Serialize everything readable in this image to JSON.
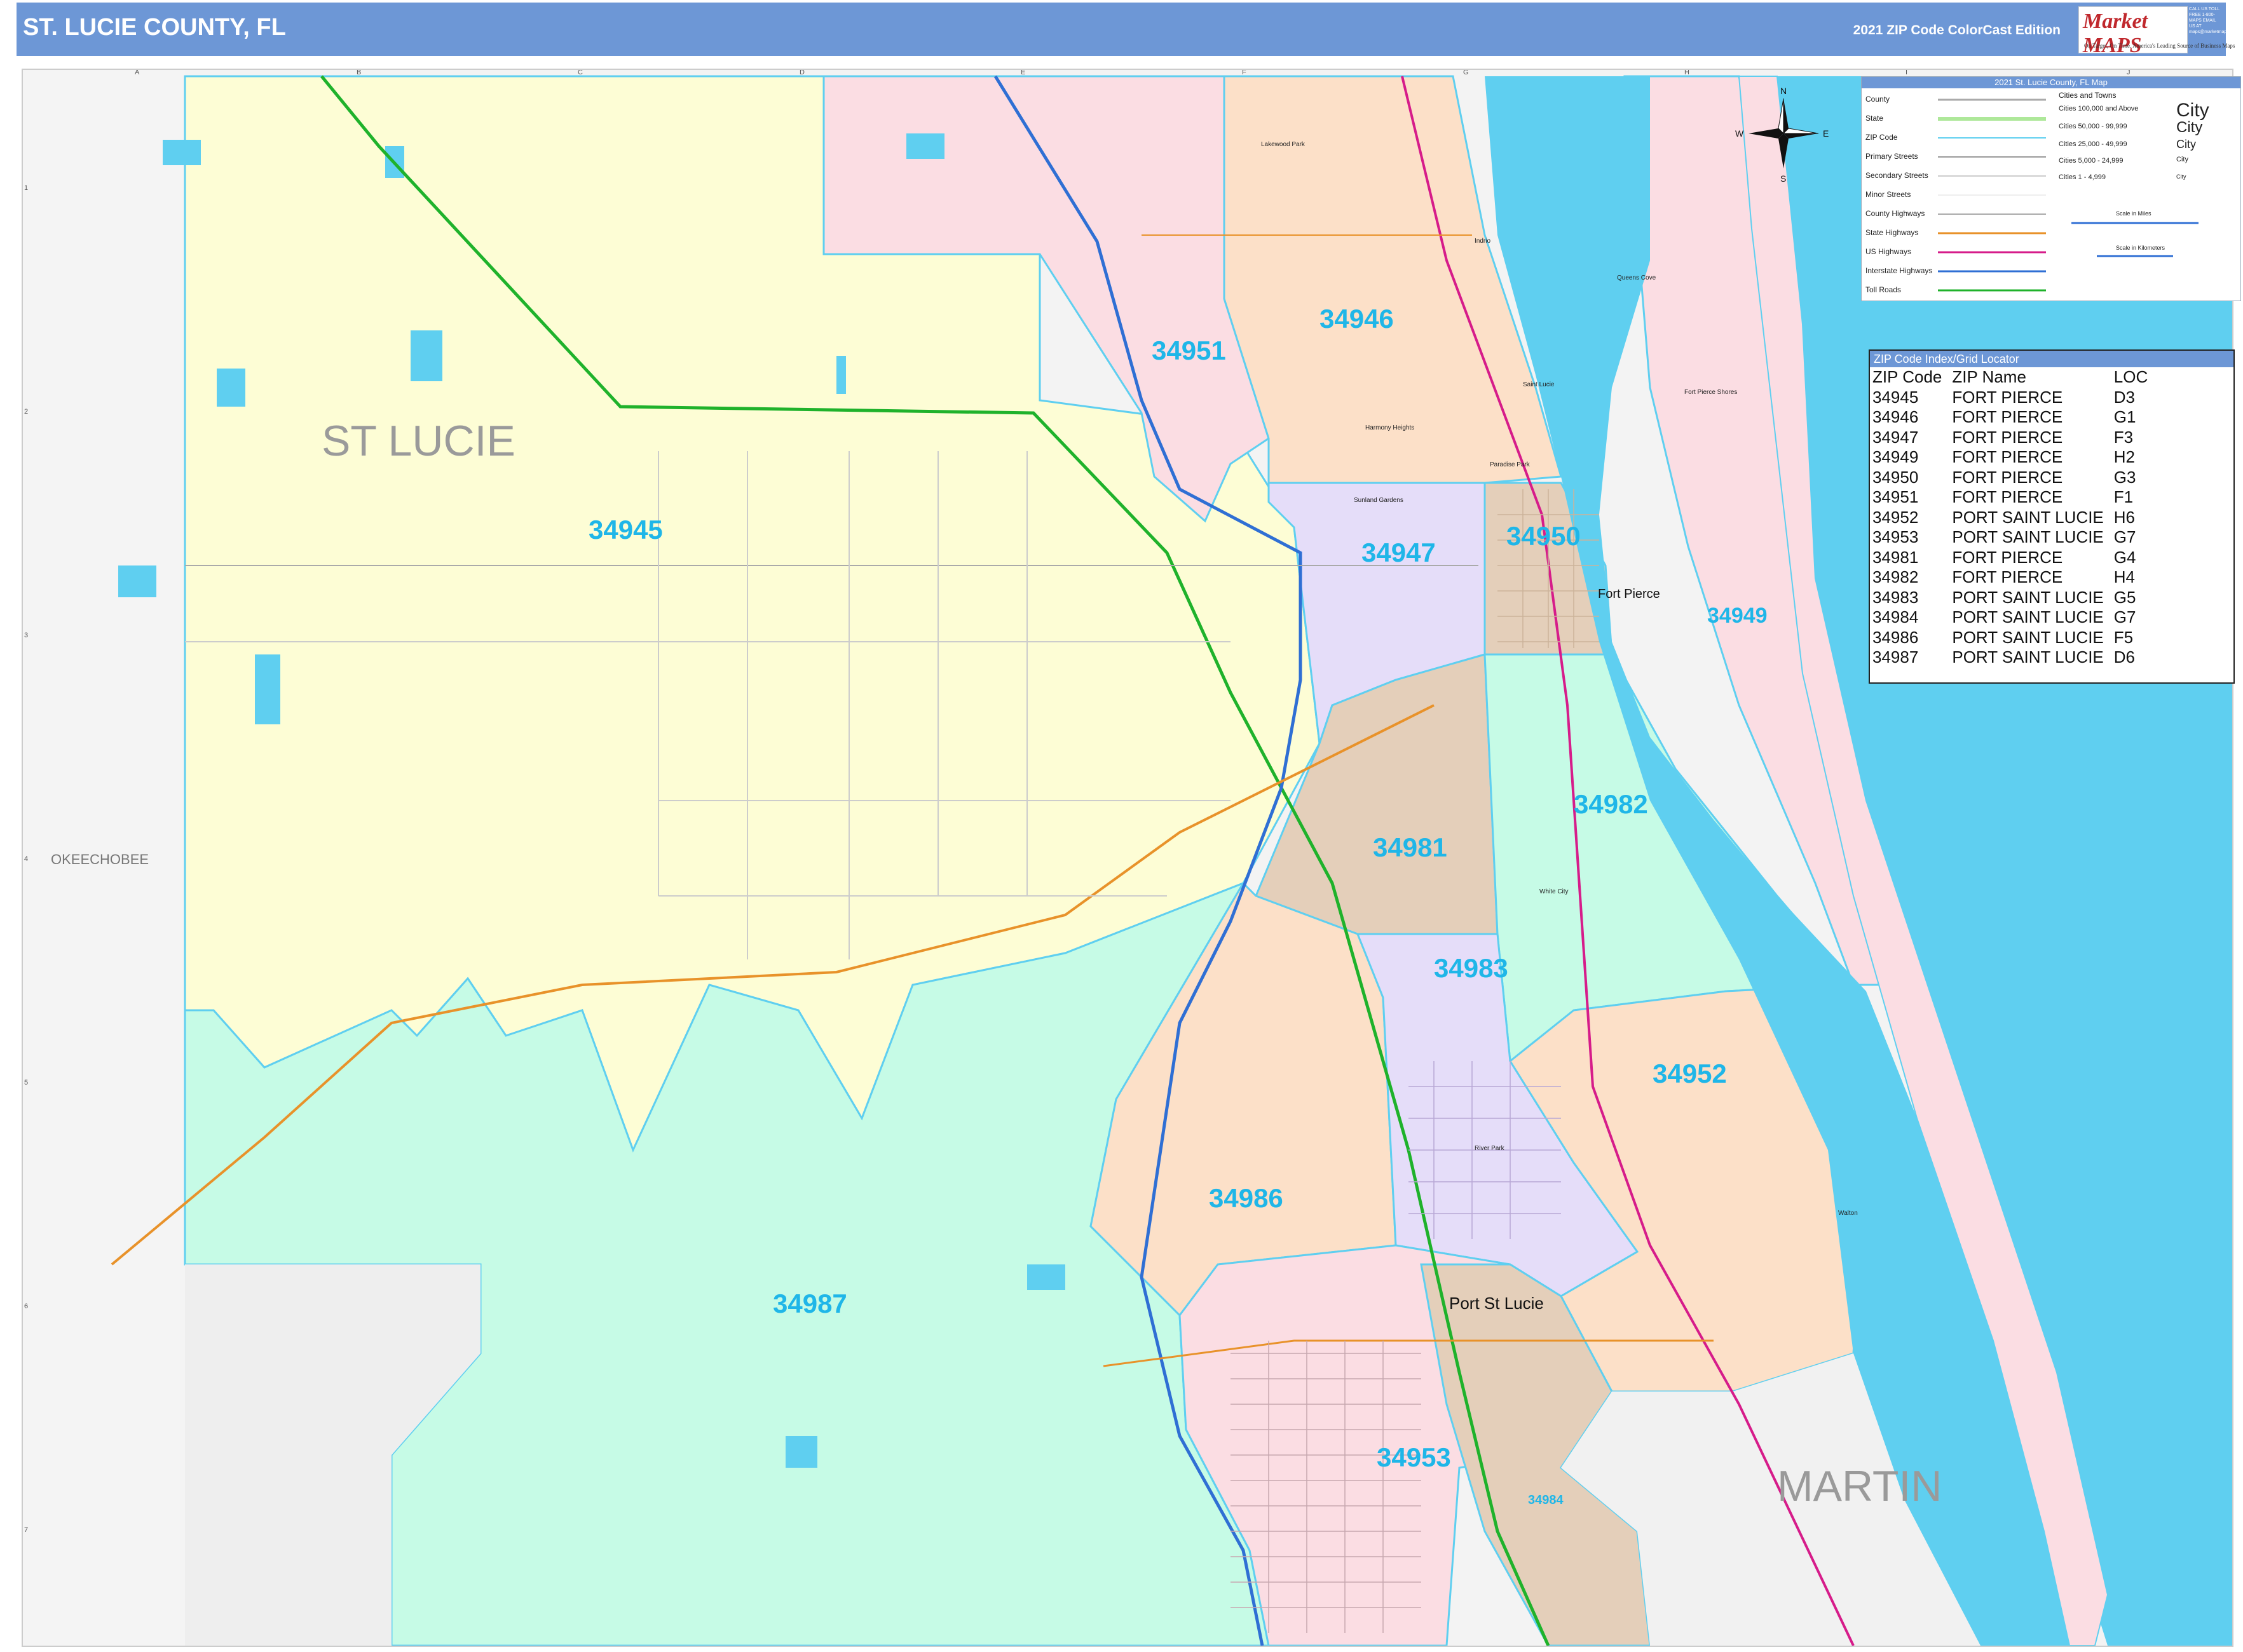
{
  "header": {
    "title": "ST. LUCIE COUNTY, FL",
    "edition": "2021 ZIP Code ColorCast Edition",
    "brand_name": "Market MAPS",
    "brand_tagline_1": "On Target, On Time.",
    "brand_tagline_2": "America's Leading Source of Business Maps",
    "contact": "CALL US TOLL FREE 1-800-MAPS EMAIL US AT maps@marketmaps.com"
  },
  "colors": {
    "header_blue": "#6d97d6",
    "water": "#5fcff0",
    "zip_label": "#1fb6e8",
    "zone_yellow": "#fdfdd5",
    "zone_green": "#c6fbe6",
    "zone_pink": "#fbdde3",
    "zone_peach": "#fce0c8",
    "zone_lavender": "#e5ddf9",
    "zone_tan": "#e4cfba",
    "interstate": "#2f6fd4",
    "turnpike": "#1fb22b",
    "us_highway": "#d61c8a",
    "state_highway": "#e8922a"
  },
  "grid": {
    "columns": [
      "A",
      "B",
      "C",
      "D",
      "E",
      "F",
      "G",
      "H",
      "I",
      "J"
    ],
    "rows": [
      "1",
      "2",
      "3",
      "4",
      "5",
      "6",
      "7"
    ]
  },
  "compass": {
    "n": "N",
    "s": "S",
    "e": "E",
    "w": "W"
  },
  "legend": {
    "title": "2021 St. Lucie County, FL Map",
    "left_items": [
      "County",
      "State",
      "ZIP Code",
      "Primary Streets",
      "Secondary Streets",
      "Minor Streets",
      "County Highways",
      "State Highways",
      "US Highways",
      "Interstate Highways",
      "Toll Roads"
    ],
    "right_title": "Cities and Towns",
    "right_items": [
      {
        "label": "Cities 100,000 and Above",
        "sample": "City"
      },
      {
        "label": "Cities 50,000 - 99,999",
        "sample": "City"
      },
      {
        "label": "Cities 25,000 - 49,999",
        "sample": "City"
      },
      {
        "label": "Cities 5,000 - 24,999",
        "sample": "City"
      },
      {
        "label": "Cities 1 - 4,999",
        "sample": "City"
      }
    ],
    "scale_miles": "Scale in Miles",
    "scale_km": "Scale in Kilometers"
  },
  "zip_index": {
    "title": "ZIP Code Index/Grid Locator",
    "headers": [
      "ZIP Code",
      "ZIP Name",
      "LOC"
    ],
    "rows": [
      [
        "34945",
        "FORT PIERCE",
        "D3"
      ],
      [
        "34946",
        "FORT PIERCE",
        "G1"
      ],
      [
        "34947",
        "FORT PIERCE",
        "F3"
      ],
      [
        "34949",
        "FORT PIERCE",
        "H2"
      ],
      [
        "34950",
        "FORT PIERCE",
        "G3"
      ],
      [
        "34951",
        "FORT PIERCE",
        "F1"
      ],
      [
        "34952",
        "PORT SAINT LUCIE",
        "H6"
      ],
      [
        "34953",
        "PORT SAINT LUCIE",
        "G7"
      ],
      [
        "34981",
        "FORT PIERCE",
        "G4"
      ],
      [
        "34982",
        "FORT PIERCE",
        "H4"
      ],
      [
        "34983",
        "PORT SAINT LUCIE",
        "G5"
      ],
      [
        "34984",
        "PORT SAINT LUCIE",
        "G7"
      ],
      [
        "34986",
        "PORT SAINT LUCIE",
        "F5"
      ],
      [
        "34987",
        "PORT SAINT LUCIE",
        "D6"
      ]
    ]
  },
  "counties": {
    "main": "ST LUCIE",
    "west": "OKEECHOBEE",
    "south": "MARTIN"
  },
  "zip_labels": {
    "z34945": "34945",
    "z34946": "34946",
    "z34947": "34947",
    "z34949": "34949",
    "z34950": "34950",
    "z34951": "34951",
    "z34952": "34952",
    "z34953": "34953",
    "z34981": "34981",
    "z34982": "34982",
    "z34983": "34983",
    "z34984": "34984",
    "z34986": "34986",
    "z34987": "34987"
  },
  "cities": {
    "fort_pierce": "Fort Pierce",
    "port_st_lucie": "Port St Lucie",
    "lakewood_park": "Lakewood Park",
    "indrio": "Indrio",
    "queens_cove": "Queens Cove",
    "saint_lucie": "Saint Lucie",
    "harmony_heights": "Harmony Heights",
    "fort_pierce_shores": "Fort Pierce Shores",
    "paradise_park": "Paradise Park",
    "sunland_gardens": "Sunland Gardens",
    "white_city": "White City",
    "river_park": "River Park",
    "walton": "Walton"
  }
}
